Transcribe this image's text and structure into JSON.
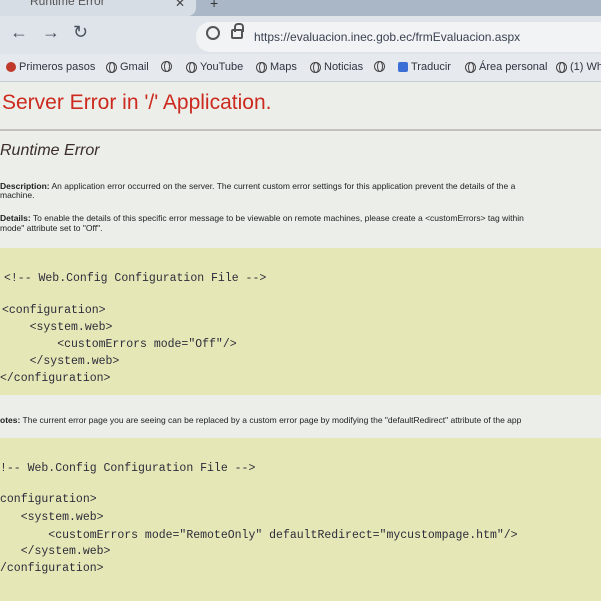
{
  "browser": {
    "tab_title": "Runtime Error",
    "tab_close_icon": "close-icon",
    "new_tab_icon": "plus-icon",
    "nav": {
      "back_icon": "arrow-left-icon",
      "forward_icon": "arrow-right-icon",
      "reload_icon": "reload-icon"
    },
    "url": "https://evaluacion.inec.gob.ec/frmEvaluacion.aspx",
    "bookmarks": [
      {
        "label": "Primeros pasos",
        "icon": "red-circle-icon"
      },
      {
        "label": "Gmail",
        "icon": "globe-icon"
      },
      {
        "label": "",
        "icon": "globe-icon"
      },
      {
        "label": "YouTube",
        "icon": "globe-icon"
      },
      {
        "label": "Maps",
        "icon": "globe-icon"
      },
      {
        "label": "Noticias",
        "icon": "globe-icon"
      },
      {
        "label": "",
        "icon": "globe-icon"
      },
      {
        "label": "Traducir",
        "icon": "translate-icon"
      },
      {
        "label": "Área personal",
        "icon": "globe-icon"
      },
      {
        "label": "(1) Wh",
        "icon": "globe-icon"
      }
    ]
  },
  "page": {
    "title": "Server Error in '/' Application.",
    "subtitle": "Runtime Error",
    "description_label": "Description:",
    "description_text": " An application error occurred on the server. The current custom error settings for this application prevent the details of the a",
    "description_text2": "machine.",
    "details_label": "Details:",
    "details_text": " To enable the details of this specific error message to be viewable on remote machines, please create a <customErrors> tag within",
    "details_text2": "mode\" attribute set to \"Off\".",
    "code1": [
      "<!-- Web.Config Configuration File -->",
      "",
      "<configuration>",
      "    <system.web>",
      "        <customErrors mode=\"Off\"/>",
      "    </system.web>",
      "</configuration>"
    ],
    "notes_label": "otes:",
    "notes_text": " The current error page you are seeing can be replaced by a custom error page by modifying the \"defaultRedirect\" attribute of the app",
    "code2": [
      "!-- Web.Config Configuration File -->",
      "",
      "configuration>",
      "   <system.web>",
      "       <customErrors mode=\"RemoteOnly\" defaultRedirect=\"mycustompage.htm\"/>",
      "   </system.web>",
      "/configuration>"
    ]
  }
}
